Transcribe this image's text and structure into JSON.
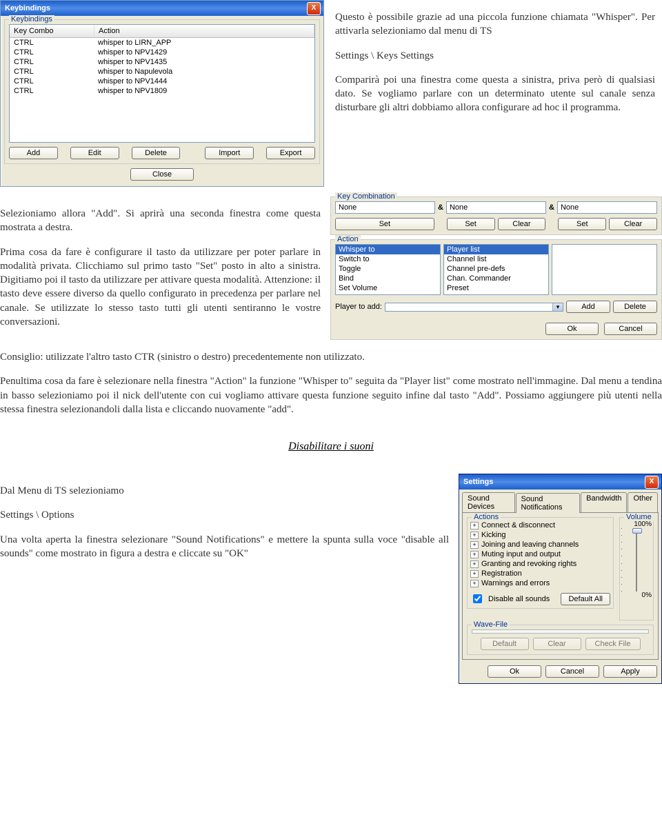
{
  "keybindings_win": {
    "title": "Keybindings",
    "group_title": "Keybindings",
    "columns": [
      "Key Combo",
      "Action"
    ],
    "rows": [
      [
        "CTRL",
        "whisper to LIRN_APP"
      ],
      [
        "CTRL",
        "whisper to NPV1429"
      ],
      [
        "CTRL",
        "whisper to NPV1435"
      ],
      [
        "CTRL",
        "whisper to Napulevola"
      ],
      [
        "CTRL",
        "whisper to NPV1444"
      ],
      [
        "CTRL",
        "whisper to NPV1809"
      ]
    ],
    "buttons": {
      "add": "Add",
      "edit": "Edit",
      "delete": "Delete",
      "import": "Import",
      "export": "Export",
      "close": "Close"
    }
  },
  "intro": {
    "p1": "Questo è possibile grazie ad una piccola funzione chiamata \"Whisper\". Per attivarla selezioniamo dal menu di TS",
    "p2": "Settings \\ Keys Settings",
    "p3": "Comparirà poi una finestra come questa a sinistra, priva però di qualsiasi dato. Se vogliamo parlare con un determinato utente sul canale senza disturbare gli altri dobbiamo allora configurare ad hoc il programma."
  },
  "mid": {
    "p1": "Selezioniamo allora \"Add\". Si aprirà una seconda finestra come questa mostrata a destra.",
    "p2": "Prima cosa da fare è configurare il tasto da utilizzare per poter parlare in modalità privata. Clicchiamo sul primo tasto \"Set\" posto in alto a sinistra. Digitiamo poi il tasto da utilizzare per attivare questa modalità. Attenzione: il tasto deve essere diverso da quello configurato in precedenza per parlare nel canale. Se utilizzate lo stesso tasto tutti gli utenti sentiranno le vostre conversazioni.",
    "p3": "Consiglio: utilizzate l'altro tasto CTR (sinistro o destro) precedentemente non utilizzato.",
    "p4": "Penultima cosa da fare è selezionare nella finestra \"Action\" la funzione \"Whisper to\" seguita da \"Player list\" come mostrato nell'immagine. Dal menu a tendina in basso selezioniamo poi il nick dell'utente con cui vogliamo attivare questa funzione seguito infine dal tasto \"Add\". Possiamo aggiungere più utenti nella stessa finestra selezionandoli dalla lista e cliccando nuovamente \"add\"."
  },
  "key_combo": {
    "title": "Key Combination",
    "none": "None",
    "amp": "&",
    "set": "Set",
    "clear": "Clear"
  },
  "action": {
    "title": "Action",
    "list1": [
      "Whisper to",
      "Switch to",
      "Toggle",
      "Bind",
      "Set Volume"
    ],
    "list2": [
      "Player list",
      "Channel list",
      "Channel pre-defs",
      "Chan. Commander",
      "Preset"
    ],
    "player_label": "Player to add:",
    "add": "Add",
    "delete": "Delete",
    "ok": "Ok",
    "cancel": "Cancel"
  },
  "section2_title": "Disabilitare i suoni",
  "section2": {
    "p1": "Dal Menu di TS selezioniamo",
    "p2": "Settings \\ Options",
    "p3": "Una volta aperta la finestra selezionare \"Sound Notifications\" e mettere la spunta sulla voce \"disable all sounds\" come mostrato in figura a destra e cliccate su \"OK\""
  },
  "settings": {
    "title": "Settings",
    "tabs": [
      "Sound Devices",
      "Sound Notifications",
      "Bandwidth",
      "Other"
    ],
    "active_tab": "Sound Notifications",
    "actions_label": "Actions",
    "volume_label": "Volume",
    "volume_val": "100%",
    "zero_val": "0%",
    "tree": [
      "Connect & disconnect",
      "Kicking",
      "Joining and leaving channels",
      "Muting input and output",
      "Granting and revoking rights",
      "Registration",
      "Warnings and errors"
    ],
    "disable_all": "Disable all sounds",
    "default_all": "Default All",
    "wave_label": "Wave-File",
    "default": "Default",
    "clear": "Clear",
    "checkfile": "Check File",
    "ok": "Ok",
    "cancel": "Cancel",
    "apply": "Apply"
  }
}
